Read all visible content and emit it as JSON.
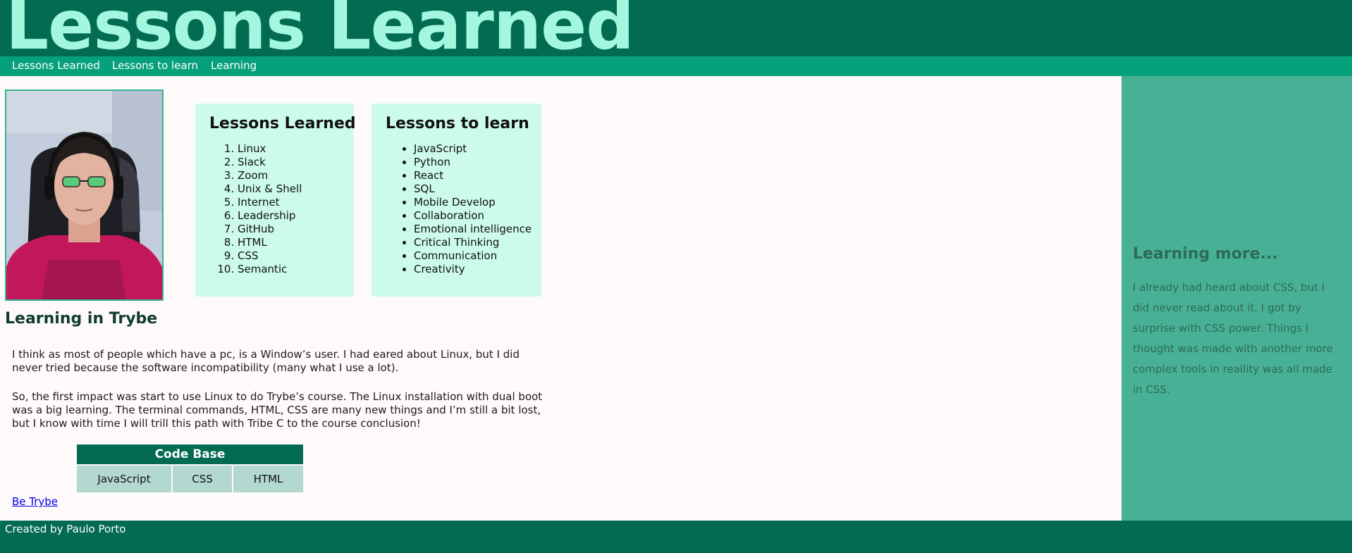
{
  "header": {
    "title": "Lessons Learned"
  },
  "nav": {
    "items": [
      {
        "label": "Lessons Learned"
      },
      {
        "label": "Lessons to learn"
      },
      {
        "label": "Learning"
      }
    ]
  },
  "profile_photo": {
    "alt": "Photo of Paulo Porto"
  },
  "lessons_learned": {
    "title": "Lessons Learned",
    "items": [
      "Linux",
      "Slack",
      "Zoom",
      "Unix & Shell",
      "Internet",
      "Leadership",
      "GitHub",
      "HTML",
      "CSS",
      "Semantic"
    ]
  },
  "lessons_to_learn": {
    "title": "Lessons to learn",
    "items": [
      "JavaScript",
      "Python",
      "React",
      "SQL",
      "Mobile Develop",
      "Collaboration",
      "Emotional intelligence",
      "Critical Thinking",
      "Communication",
      "Creativity"
    ]
  },
  "main": {
    "section_title": "Learning in Trybe",
    "paragraphs": [
      "I think as most of people which have a pc, is a Window’s user. I had eared about Linux, but I did never tried because the software incompatibility (many what I use a lot).",
      "So, the first impact was start to use Linux to do Trybe’s course. The Linux installation with dual boot was a big learning. The terminal commands, HTML, CSS are many new things and I’m still a bit lost, but I know with time I will trill this path with Tribe C to the course conclusion!"
    ],
    "code_table": {
      "caption": "Code Base",
      "cells": [
        "JavaScript",
        "CSS",
        "HTML"
      ]
    },
    "link": "Be Trybe"
  },
  "aside": {
    "title": "Learning more...",
    "text": "I already had heard about CSS, but I did never read about it. I got by surprise with CSS power. Things I thought was made with another more complex tools in reallity was all made in CSS."
  },
  "footer": {
    "text": "Created by Paulo Porto"
  },
  "colors": {
    "header_bg": "#036b52",
    "title_text": "#a3f7df",
    "nav_bg": "#06a07a",
    "card_bg": "#ccfaeb",
    "aside_bg": "#48b195",
    "table_header_bg": "#036b52",
    "table_cell_bg": "#b2d8cf"
  }
}
